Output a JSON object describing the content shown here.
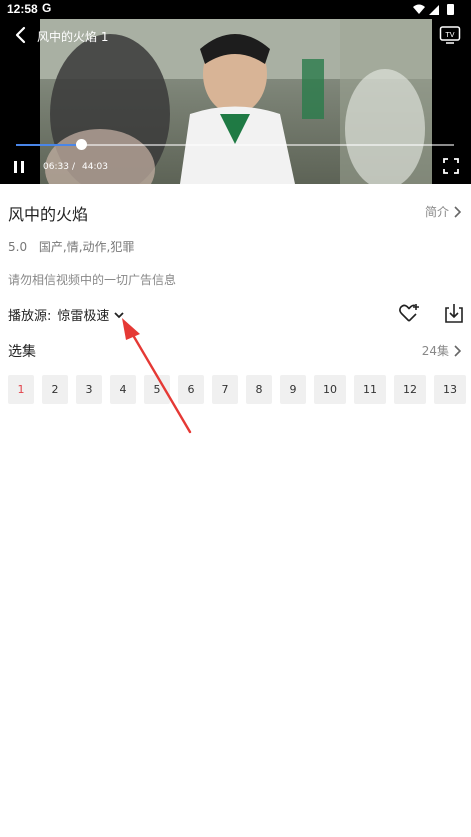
{
  "status_bar": {
    "time": "12:58",
    "carrier_icon": "G"
  },
  "player": {
    "title": "风中的火焰 1",
    "current_time": "06:33",
    "separator": "/",
    "total_time": "44:03",
    "progress": 0.149
  },
  "info": {
    "title": "风中的火焰",
    "intro_label": "简介",
    "rating": "5.0",
    "genres": "国产,情,动作,犯罪",
    "notice": "请勿相信视频中的一切广告信息",
    "source_label": "播放源:",
    "source_value": "惊雷极速"
  },
  "episodes": {
    "title": "选集",
    "count_label": "24集",
    "items": [
      "1",
      "2",
      "3",
      "4",
      "5",
      "6",
      "7",
      "8",
      "9",
      "10",
      "11",
      "12",
      "13"
    ],
    "active": "1"
  },
  "colors": {
    "accent": "#e2424a",
    "progress": "#4a86e8"
  }
}
